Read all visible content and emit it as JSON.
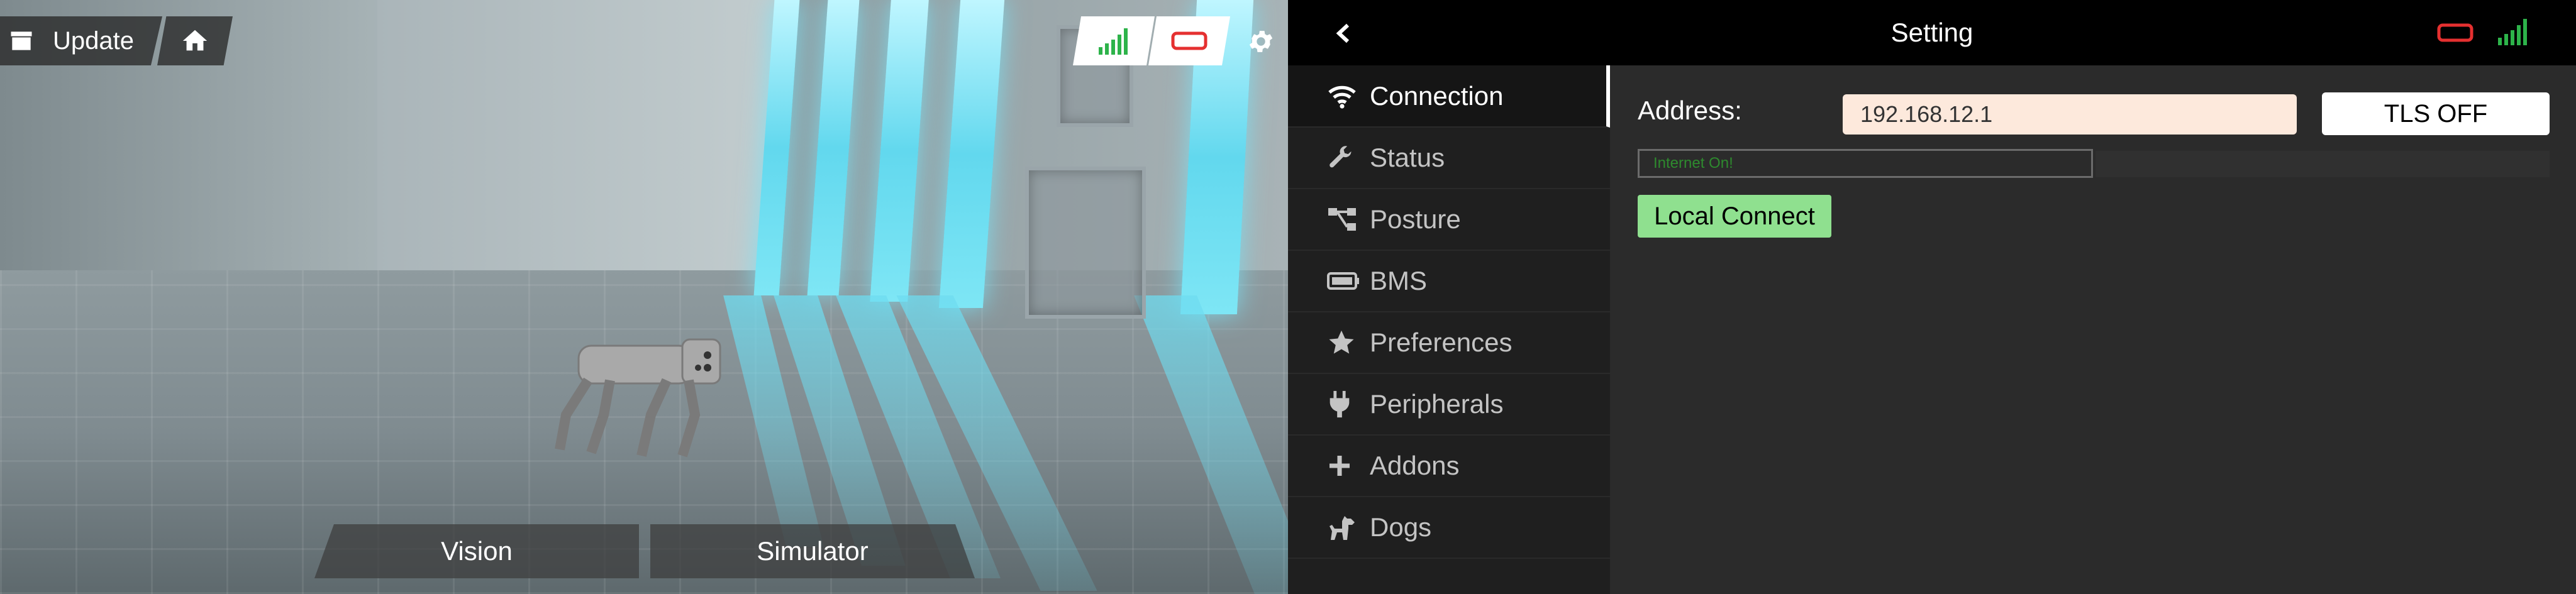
{
  "viewport": {
    "toolbar": {
      "update_label": "Update"
    },
    "bottom_tabs": [
      {
        "label": "Vision"
      },
      {
        "label": "Simulator"
      }
    ]
  },
  "settings": {
    "title": "Setting",
    "nav": [
      {
        "label": "Connection",
        "icon": "wifi-icon",
        "active": true
      },
      {
        "label": "Status",
        "icon": "wrench-icon"
      },
      {
        "label": "Posture",
        "icon": "hierarchy-icon"
      },
      {
        "label": "BMS",
        "icon": "battery-icon"
      },
      {
        "label": "Preferences",
        "icon": "star-icon"
      },
      {
        "label": "Peripherals",
        "icon": "plug-icon"
      },
      {
        "label": "Addons",
        "icon": "plus-icon"
      },
      {
        "label": "Dogs",
        "icon": "dog-icon"
      }
    ],
    "connection": {
      "address_label": "Address:",
      "address_value": "192.168.12.1",
      "tls_label": "TLS OFF",
      "internet_status": "Internet On!",
      "local_connect_label": "Local Connect"
    }
  },
  "colors": {
    "accent_signal": "#2db34a",
    "battery_alert": "#e53030",
    "local_connect_bg": "#8fe08f",
    "address_bg": "#fde9dc",
    "internet_text": "#2e8a2e"
  }
}
